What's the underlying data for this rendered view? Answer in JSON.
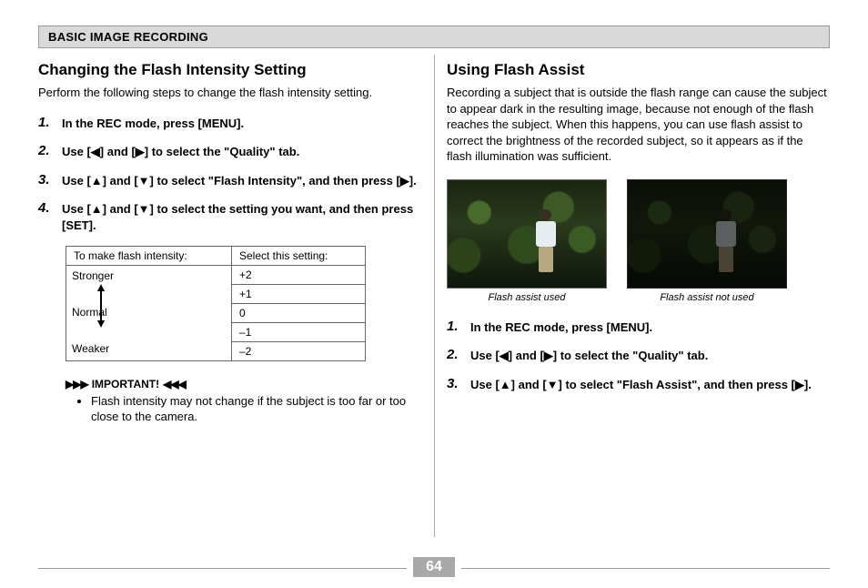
{
  "section_title": "BASIC IMAGE RECORDING",
  "page_number": "64",
  "left": {
    "heading": "Changing the Flash Intensity Setting",
    "intro": "Perform the following steps to change the flash intensity setting.",
    "steps": [
      "In the REC mode, press [MENU].",
      "Use [◀] and [▶] to select the \"Quality\" tab.",
      "Use [▲] and [▼] to select \"Flash Intensity\", and then press [▶].",
      "Use [▲] and [▼] to select the setting you want, and then press [SET]."
    ],
    "table": {
      "header_left": "To make flash intensity:",
      "header_right": "Select this setting:",
      "rows": [
        {
          "left": "Stronger",
          "right": "+2"
        },
        {
          "left": "",
          "right": "+1"
        },
        {
          "left": "Normal",
          "right": " 0"
        },
        {
          "left": "",
          "right": "–1"
        },
        {
          "left": "Weaker",
          "right": "–2"
        }
      ]
    },
    "important_label": "IMPORTANT!",
    "important_note": "Flash intensity may not change if the subject is too far or too close to the camera."
  },
  "right": {
    "heading": "Using Flash Assist",
    "intro": "Recording a subject that is outside the flash range can cause the subject to appear dark in the resulting image, because not enough of the flash reaches the subject. When this happens, you can use flash assist to correct the brightness of the recorded subject, so it appears as if the flash illumination was sufficient.",
    "caption_used": "Flash assist used",
    "caption_not_used": "Flash assist not used",
    "steps": [
      "In the REC mode, press [MENU].",
      "Use [◀] and [▶] to select the \"Quality\" tab.",
      "Use [▲] and [▼] to select \"Flash Assist\", and then press [▶]."
    ]
  }
}
